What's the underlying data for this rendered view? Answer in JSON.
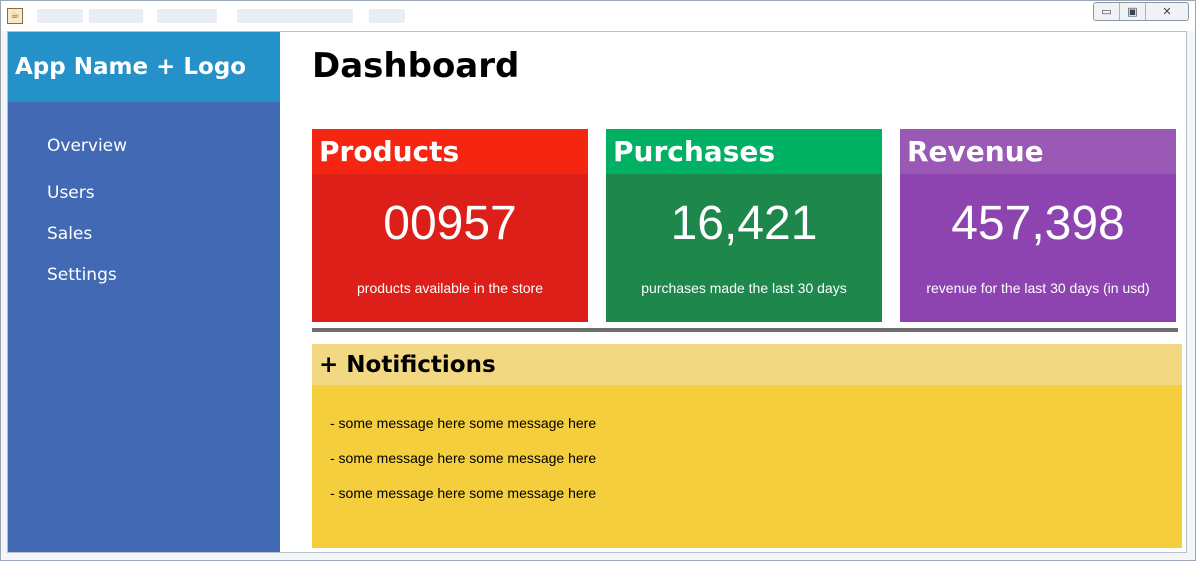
{
  "window": {
    "controls": {
      "minimize": "▭",
      "maximize": "▣",
      "close": "✕"
    }
  },
  "sidebar": {
    "brand": "App Name + Logo",
    "items": [
      {
        "label": "Overview"
      },
      {
        "label": "Users"
      },
      {
        "label": "Sales"
      },
      {
        "label": "Settings"
      }
    ]
  },
  "main": {
    "title": "Dashboard",
    "cards": [
      {
        "title": "Products",
        "value": "00957",
        "caption": "products available in the store"
      },
      {
        "title": "Purchases",
        "value": "16,421",
        "caption": "purchases made the last 30 days"
      },
      {
        "title": "Revenue",
        "value": "457,398",
        "caption": "revenue for the last 30 days (in usd)"
      }
    ],
    "notifications": {
      "toggle": "+",
      "title": "Notifictions",
      "messages": [
        "- some message here some message here",
        "- some message here some message here",
        "- some message here some message here"
      ]
    }
  },
  "colors": {
    "sidebar": "#4169b4",
    "brand": "#2491c9",
    "products": "#dd1f19",
    "purchases": "#1d874c",
    "revenue": "#8e44b0",
    "notifications": "#f4ce3d"
  }
}
